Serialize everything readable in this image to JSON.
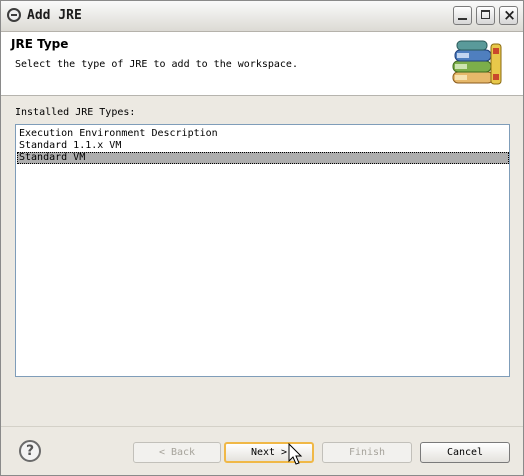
{
  "window": {
    "title": "Add JRE"
  },
  "header": {
    "title": "JRE Type",
    "description": "Select the type of JRE to add to the workspace."
  },
  "types": {
    "label": "Installed JRE Types:",
    "items": [
      {
        "label": "Execution Environment Description",
        "selected": false
      },
      {
        "label": "Standard 1.1.x VM",
        "selected": false
      },
      {
        "label": "Standard VM",
        "selected": true
      }
    ]
  },
  "buttons": {
    "back": "< Back",
    "next": "Next >",
    "finish": "Finish",
    "cancel": "Cancel",
    "help": "?"
  },
  "icons": {
    "app": "eclipse-icon",
    "header": "books-icon",
    "help": "help-icon",
    "cursor": "mouse-pointer-icon"
  },
  "colors": {
    "selection": "#adadad",
    "default_button_border": "#f0b847",
    "window_background": "#ece9e2"
  }
}
